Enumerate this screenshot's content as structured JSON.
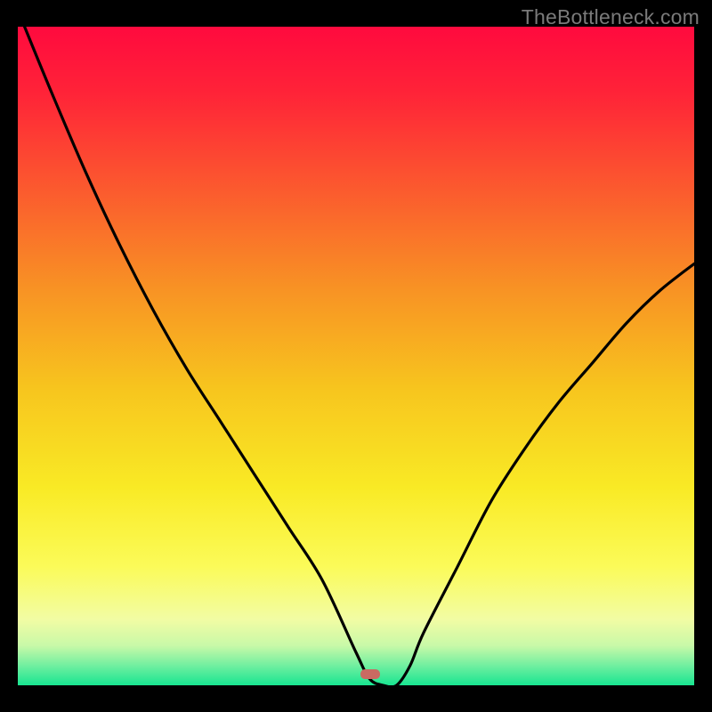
{
  "watermark": "TheBottleneck.com",
  "marker_color": "#c96a62",
  "chart_data": {
    "type": "line",
    "title": "",
    "xlabel": "",
    "ylabel": "",
    "xlim": [
      0,
      100
    ],
    "ylim": [
      0,
      100
    ],
    "grid": false,
    "legend": false,
    "background": "red-yellow-green-vertical-gradient",
    "annotations": [
      {
        "text": "TheBottleneck.com",
        "position": "top-right",
        "color": "#7a7a7a"
      }
    ],
    "marker": {
      "x": 53,
      "y": 0,
      "color": "#c96a62",
      "shape": "pill"
    },
    "series": [
      {
        "name": "bottleneck-curve",
        "color": "#000000",
        "x": [
          1,
          5,
          10,
          15,
          20,
          25,
          30,
          35,
          40,
          45,
          50,
          52,
          54,
          56,
          58,
          60,
          65,
          70,
          75,
          80,
          85,
          90,
          95,
          100
        ],
        "y": [
          100,
          90,
          78,
          67,
          57,
          48,
          40,
          32,
          24,
          16,
          5,
          1,
          0,
          0,
          3,
          8,
          18,
          28,
          36,
          43,
          49,
          55,
          60,
          64
        ]
      }
    ],
    "gradient_stops": [
      {
        "offset": 0.0,
        "color": "#ff0a3e"
      },
      {
        "offset": 0.1,
        "color": "#ff2338"
      },
      {
        "offset": 0.25,
        "color": "#fb5b2e"
      },
      {
        "offset": 0.4,
        "color": "#f89324"
      },
      {
        "offset": 0.55,
        "color": "#f7c51e"
      },
      {
        "offset": 0.7,
        "color": "#f9ea25"
      },
      {
        "offset": 0.82,
        "color": "#fbfb59"
      },
      {
        "offset": 0.9,
        "color": "#f2fca4"
      },
      {
        "offset": 0.94,
        "color": "#c8f9a8"
      },
      {
        "offset": 0.97,
        "color": "#71efa0"
      },
      {
        "offset": 1.0,
        "color": "#18e591"
      }
    ]
  }
}
